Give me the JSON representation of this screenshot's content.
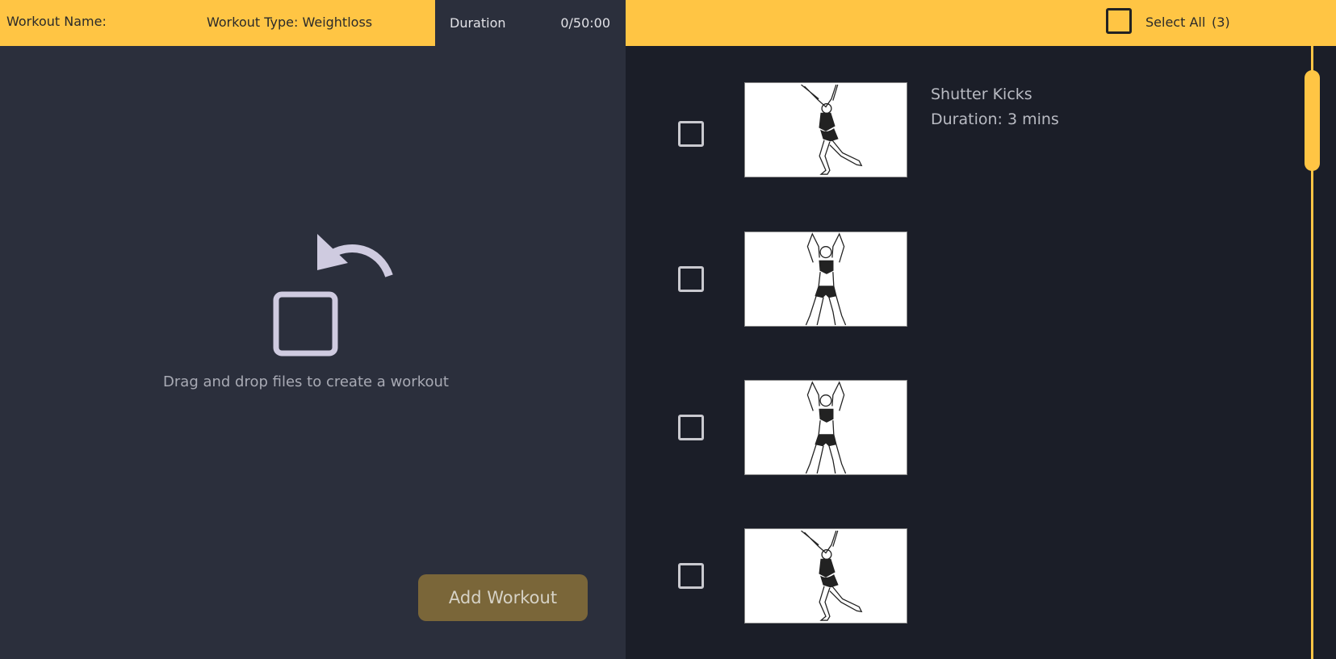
{
  "header": {
    "workout_name_label": "Workout Name:",
    "workout_type_label": "Workout Type: Weightloss",
    "duration_label": "Duration",
    "duration_value": "0/50:00",
    "select_all_label": "Select All",
    "select_all_count": "(3)"
  },
  "dropzone": {
    "text": "Drag and drop files to create a workout",
    "icon": "undo-square-icon"
  },
  "add_button_label": "Add Workout",
  "exercises": [
    {
      "name": "Shutter Kicks",
      "duration": "Duration: 3 mins",
      "pose": "side-kick"
    },
    {
      "name": "",
      "duration": "",
      "pose": "arms-up"
    },
    {
      "name": "",
      "duration": "",
      "pose": "arms-up"
    },
    {
      "name": "",
      "duration": "",
      "pose": "side-kick"
    }
  ],
  "colors": {
    "accent": "#ffc544",
    "left_panel": "#2b2f3c",
    "right_panel": "#1b1e28",
    "button": "#7a6639"
  }
}
